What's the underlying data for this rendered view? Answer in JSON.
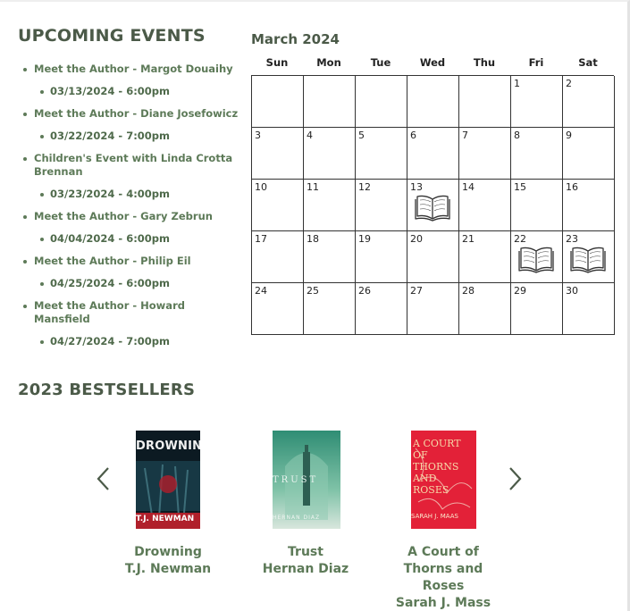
{
  "events": {
    "heading": "UPCOMING EVENTS",
    "items": [
      {
        "title": "Meet the Author - Margot Douaihy",
        "date": "03/13/2024 - 6:00pm"
      },
      {
        "title": "Meet the Author - Diane Josefowicz",
        "date": "03/22/2024 - 7:00pm"
      },
      {
        "title": "Children's Event with Linda Crotta Brennan",
        "date": "03/23/2024 - 4:00pm"
      },
      {
        "title": "Meet the Author - Gary Zebrun",
        "date": "04/04/2024 - 6:00pm"
      },
      {
        "title": "Meet the Author - Philip Eil",
        "date": "04/25/2024 - 6:00pm"
      },
      {
        "title": "Meet the Author - Howard Mansfield",
        "date": "04/27/2024 - 7:00pm"
      }
    ]
  },
  "calendar": {
    "title": "March 2024",
    "weekdays": [
      "Sun",
      "Mon",
      "Tue",
      "Wed",
      "Thu",
      "Fri",
      "Sat"
    ],
    "first_weekday_index": 5,
    "days_in_month": 30,
    "event_days": [
      13,
      22,
      23
    ],
    "event_icon": "open-book-icon"
  },
  "bestsellers": {
    "heading": "2023 BESTSELLERS",
    "prev_icon": "chevron-left-icon",
    "next_icon": "chevron-right-icon",
    "books": [
      {
        "title": "Drowning",
        "author": "T.J. Newman",
        "cover_text": "DROWNING",
        "cover_author": "T.J. NEWMAN",
        "cover_color": "#0c1a22"
      },
      {
        "title": "Trust",
        "author": "Hernan Diaz",
        "cover_text": "TRUST",
        "cover_author": "HERNAN DIAZ",
        "cover_color": "#3a9a7e"
      },
      {
        "title": "A Court of Thorns and Roses",
        "author": "Sarah J. Mass",
        "cover_text": "A COURT OF THORNS AND ROSES",
        "cover_author": "SARAH J. MAAS",
        "cover_color": "#e8243c"
      }
    ]
  }
}
